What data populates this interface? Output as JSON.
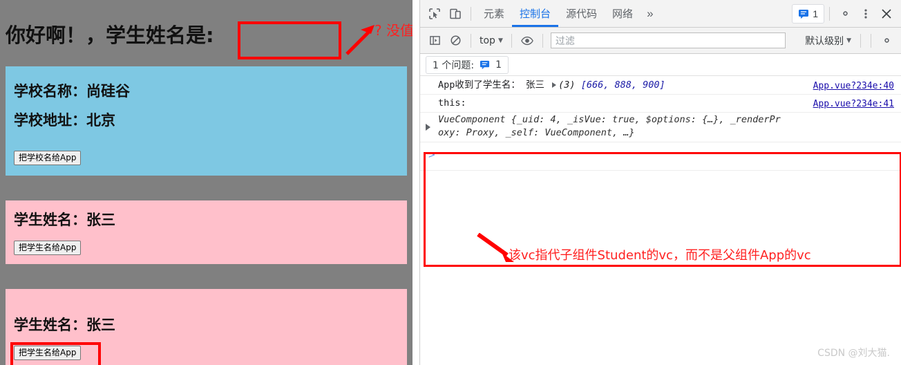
{
  "page": {
    "greeting": "你好啊！，学生姓名是:",
    "name_input_value": "",
    "annotation_no_value": "? 没值",
    "school_card": {
      "name_line": "学校名称：尚硅谷",
      "address_line": "学校地址：北京",
      "button_label": "把学校名给App"
    },
    "student_cards": [
      {
        "name_line": "学生姓名：张三",
        "button_label": "把学生名给App"
      },
      {
        "name_line": "学生姓名：张三",
        "button_label": "把学生名给App"
      }
    ],
    "colors": {
      "background": "#808080",
      "school_panel": "#7ec8e3",
      "student_panel": "#ffc0cb",
      "annotation": "#ff0000"
    }
  },
  "devtools": {
    "tabs": [
      {
        "label": "元素",
        "active": false
      },
      {
        "label": "控制台",
        "active": true
      },
      {
        "label": "源代码",
        "active": false
      },
      {
        "label": "网络",
        "active": false
      }
    ],
    "more_tabs_label": "»",
    "message_count": "1",
    "toolbar_icons": {
      "inspect": "inspect-element-icon",
      "device": "device-toolbar-icon",
      "settings": "gear-icon",
      "menu": "kebab-menu-icon",
      "close": "close-icon"
    },
    "console_bar": {
      "sidebar_toggle": "console-sidebar-icon",
      "clear_label": "clear-console-icon",
      "context": "top",
      "eye_icon": "live-expression-icon",
      "filter_placeholder": "过滤",
      "filter_value": "",
      "level": "默认级别",
      "settings_icon": "gear-icon"
    },
    "issues_bar": {
      "label": "1 个问题:",
      "count": "1"
    },
    "console_logs": [
      {
        "text_prefix": "App收到了学生名：",
        "value": "张三",
        "array_count": "(3)",
        "array_preview": "[666, 888, 900]",
        "source": "App.vue?234e:40"
      },
      {
        "text_prefix": "this:",
        "source": "App.vue?234e:41",
        "object_line1": "VueComponent {_uid: 4, _isVue: true, $options: {…}, _renderPr",
        "object_line2": "oxy: Proxy, _self: VueComponent, …}",
        "uid_key": "_uid:",
        "uid_val": "4",
        "isvue_key": "_isVue:",
        "isvue_val": "true",
        "options_key": "$options:",
        "options_val": "{…}"
      }
    ],
    "prompt_symbol": ">",
    "annotation": "该vc指代子组件Student的vc，而不是父组件App的vc"
  },
  "watermark": "CSDN @刘大猫."
}
